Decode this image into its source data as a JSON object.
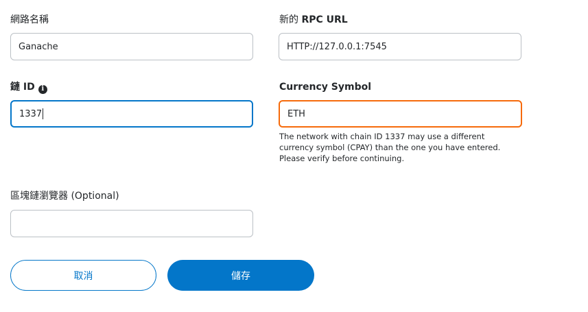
{
  "network_name": {
    "label": "網路名稱",
    "value": "Ganache"
  },
  "rpc_url": {
    "label_prefix": "新的 ",
    "label_bold": "RPC URL",
    "value": "HTTP://127.0.0.1:7545"
  },
  "chain_id": {
    "label_prefix": "鏈 ",
    "label_bold": "ID",
    "info_icon": "i",
    "value": "1337"
  },
  "currency_symbol": {
    "label": "Currency Symbol",
    "value": "ETH",
    "warning": "The network with chain ID 1337 may use a different currency symbol (CPAY) than the one you have entered. Please verify before continuing."
  },
  "block_explorer": {
    "label": "區塊鏈瀏覽器",
    "optional": "(Optional)",
    "value": ""
  },
  "buttons": {
    "cancel": "取消",
    "save": "儲存"
  },
  "colors": {
    "accent": "#0376c9",
    "warning": "#f66a0a",
    "border": "#bbc0c5"
  }
}
